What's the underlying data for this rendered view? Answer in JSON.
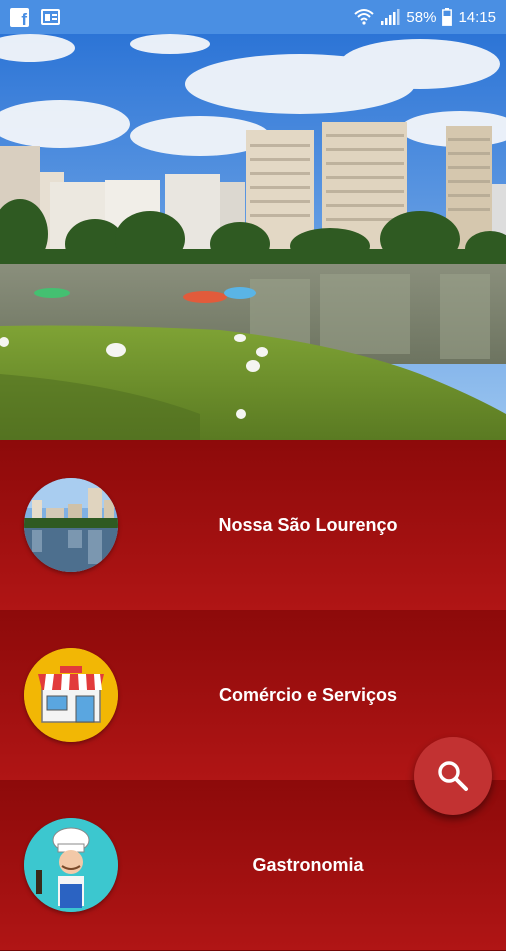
{
  "status_bar": {
    "battery": "58%",
    "time": "14:15",
    "left_icons": [
      "facebook-icon",
      "news-icon"
    ],
    "right_icons": [
      "wifi-icon",
      "signal-icon",
      "battery-icon"
    ]
  },
  "hero": {
    "image": "lake-city-skyline-with-geese"
  },
  "menu": {
    "items": [
      {
        "label": "Nossa São Lourenço",
        "icon": "city-lake-thumbnail"
      },
      {
        "label": "Comércio e Serviços",
        "icon": "shop-icon"
      },
      {
        "label": "Gastronomia",
        "icon": "chef-icon"
      }
    ]
  },
  "fab": {
    "icon": "search-icon"
  },
  "colors": {
    "status_bar": "#4a8fe3",
    "primary": "#a00f0f",
    "fab": "#c23232",
    "text": "#ffffff"
  }
}
